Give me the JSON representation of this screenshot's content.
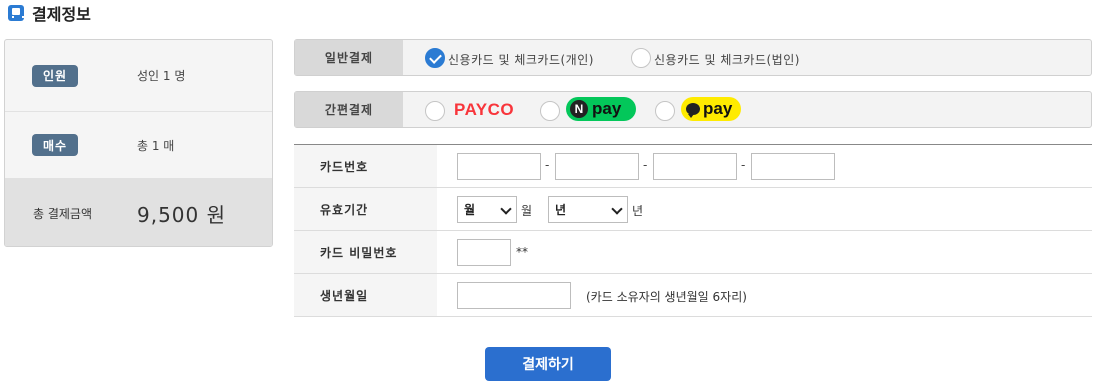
{
  "title": "결제정보",
  "summary": {
    "people_label": "인원",
    "people_value": "성인 1 명",
    "tickets_label": "매수",
    "tickets_value": "총 1 매",
    "total_label": "총 결제금액",
    "total_value": "9,500 원"
  },
  "general_payment": {
    "label": "일반결제",
    "options": [
      {
        "label": "신용카드 및 체크카드(개인)",
        "checked": true
      },
      {
        "label": "신용카드 및 체크카드(법인)",
        "checked": false
      }
    ]
  },
  "simple_payment": {
    "label": "간편결제",
    "options": [
      {
        "label": "PAYCO",
        "checked": false
      },
      {
        "label_badge": "N",
        "label": "pay",
        "checked": false
      },
      {
        "label": "pay",
        "checked": false
      }
    ]
  },
  "form": {
    "card_number_label": "카드번호",
    "card_number_separator": "-",
    "expiry_label": "유효기간",
    "month_select": "월",
    "month_unit": "월",
    "year_select": "년",
    "year_unit": "년",
    "password_label": "카드 비밀번호",
    "password_suffix": "**",
    "birth_label": "생년월일",
    "birth_hint": "(카드 소유자의 생년월일 6자리)"
  },
  "submit_label": "결제하기",
  "colors": {
    "accent": "#2b7bd3",
    "badge": "#52708c",
    "payco": "#f8353b",
    "npay": "#03c75a",
    "kakaopay": "#ffeb00"
  }
}
